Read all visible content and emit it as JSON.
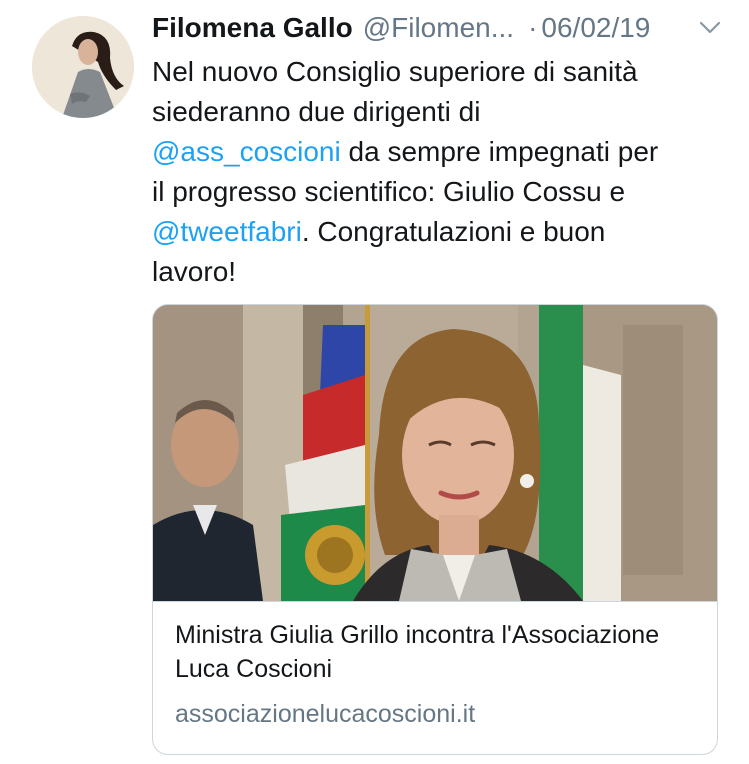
{
  "tweet": {
    "author_name": "Filomena Gallo",
    "author_handle": "@Filomen...",
    "separator": "·",
    "date": "06/02/19",
    "text": {
      "line1": "Nel nuovo Consiglio superiore di sanità",
      "line2": "siederanno due dirigenti di",
      "line3_mention": "@ass_coscioni",
      "line3_rest": " da sempre impegnati per",
      "line4": "il progresso scientifico: Giulio Cossu e",
      "line5_mention": "@tweetfabri",
      "line5_rest": ". Congratulazioni e buon",
      "line6": "lavoro!"
    }
  },
  "card": {
    "title": "Ministra Giulia Grillo incontra l'Associazione Luca Coscioni",
    "domain": "associazionelucacoscioni.it"
  },
  "colors": {
    "link": "#1da1f2",
    "secondary_text": "#657786",
    "border": "#ccd6dd"
  },
  "icons": {
    "menu": "chevron-down-icon"
  }
}
